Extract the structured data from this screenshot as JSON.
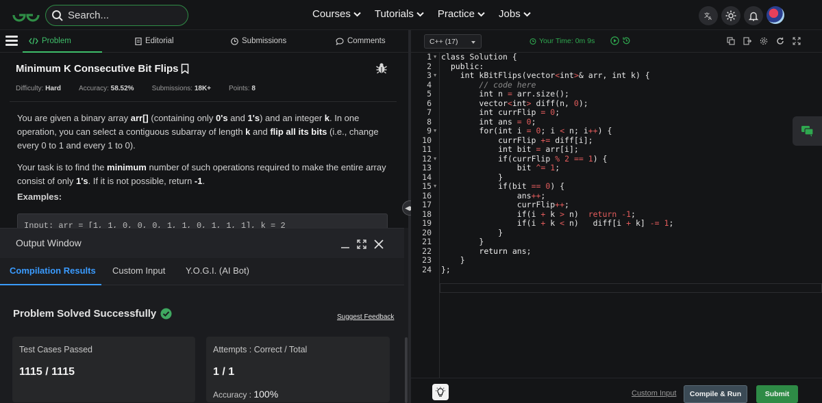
{
  "colors": {
    "brand_green": "#2f8d46",
    "accent_blue": "#3a9bff",
    "submit_green": "#2e8b46"
  },
  "header": {
    "search_placeholder": "Search...",
    "nav": [
      {
        "label": "Courses"
      },
      {
        "label": "Tutorials"
      },
      {
        "label": "Practice"
      },
      {
        "label": "Jobs"
      }
    ],
    "icons": [
      "translate-icon",
      "theme-toggle-icon",
      "notification-bell-icon",
      "avatar"
    ]
  },
  "problem_tabs": [
    {
      "label": "Problem",
      "icon": "code-icon"
    },
    {
      "label": "Editorial",
      "icon": "document-icon"
    },
    {
      "label": "Submissions",
      "icon": "clock-icon"
    },
    {
      "label": "Comments",
      "icon": "comment-icon"
    }
  ],
  "problem": {
    "title": "Minimum K Consecutive Bit Flips",
    "difficulty_label": "Difficulty:",
    "difficulty": "Hard",
    "accuracy_label": "Accuracy:",
    "accuracy": "58.52%",
    "submissions_label": "Submissions:",
    "submissions": "18K+",
    "points_label": "Points:",
    "points": "8",
    "p1_a": "You are given a binary array ",
    "p1_b": "arr[]",
    "p1_c": " (containing only ",
    "p1_d": "0's",
    "p1_e": " and ",
    "p1_f": "1's",
    "p1_g": ") and an integer ",
    "p1_h": "k",
    "p1_i": ". In one operation, you can select a contiguous subarray of length ",
    "p1_j": "k",
    "p1_k": " and ",
    "p1_l": "flip all its bits",
    "p1_m": " (i.e., change every 0 to 1 and every 1 to 0).",
    "p2_a": "Your task is to find the ",
    "p2_b": "minimum",
    "p2_c": " number of such operations required to make the entire array consist of only ",
    "p2_d": "1's",
    "p2_e": ". If it is not possible, return ",
    "p2_f": "-1",
    "p2_g": ".",
    "examples_label": "Examples:",
    "example_input": "Input: arr = [1, 1, 0, 0, 0, 1, 1, 0, 1, 1, 1], k = 2"
  },
  "output_window": {
    "title": "Output Window",
    "tabs": [
      "Compilation Results",
      "Custom Input",
      "Y.O.G.I. (AI Bot)"
    ],
    "status": "Problem Solved Successfully",
    "feedback": "Suggest Feedback",
    "card1_title": "Test Cases Passed",
    "card1_value": "1115 / 1115",
    "card2_title": "Attempts : Correct / Total",
    "card2_value": "1 / 1",
    "accuracy_label": "Accuracy : ",
    "accuracy_value": "100%"
  },
  "editor": {
    "language": "C++ (17)",
    "timer": "Your Time: 0m 9s",
    "custom_input": "Custom Input",
    "compile_run": "Compile & Run",
    "submit": "Submit"
  }
}
